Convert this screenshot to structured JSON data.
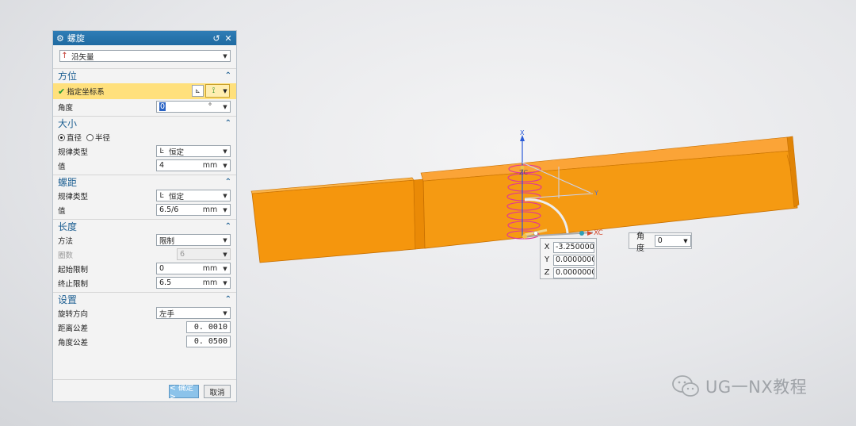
{
  "dialog": {
    "title": "螺旋",
    "type_select": "沿矢量",
    "sections": {
      "orientation": {
        "title": "方位",
        "specify_csys": "指定坐标系",
        "angle_label": "角度",
        "angle_value": "0",
        "angle_unit": "°"
      },
      "size": {
        "title": "大小",
        "radio_diameter": "直径",
        "radio_radius": "半径",
        "law_type_label": "规律类型",
        "law_type_value": "恒定",
        "value_label": "值",
        "value": "4",
        "unit": "mm"
      },
      "pitch": {
        "title": "螺距",
        "law_type_label": "规律类型",
        "law_type_value": "恒定",
        "value_label": "值",
        "value": "6.5/6",
        "unit": "mm"
      },
      "length": {
        "title": "长度",
        "method_label": "方法",
        "method_value": "限制",
        "turns_label": "圈数",
        "turns_value": "6",
        "start_label": "起始限制",
        "start_value": "0",
        "start_unit": "mm",
        "end_label": "终止限制",
        "end_value": "6.5",
        "end_unit": "mm"
      },
      "settings": {
        "title": "设置",
        "rotation_label": "旋转方向",
        "rotation_value": "左手",
        "dist_tol_label": "距离公差",
        "dist_tol_value": "0. 0010",
        "angle_tol_label": "角度公差",
        "angle_tol_value": "0. 0500"
      }
    },
    "buttons": {
      "ok": "< 确定 >",
      "cancel": "取消"
    }
  },
  "viewport": {
    "coords": {
      "x_label": "X",
      "x_value": "-3.2500000",
      "y_label": "Y",
      "y_value": "0.0000000",
      "z_label": "Z",
      "z_value": "0.0000000"
    },
    "angle_label": "角度",
    "angle_value": "0",
    "axis_labels": {
      "x": "X",
      "y": "Y",
      "zc": "ZC",
      "xc": "XC"
    }
  },
  "watermark": "UG一NX教程",
  "colors": {
    "part": "#f5960d",
    "helix": "#e0349a",
    "title_bar": "#2470a9",
    "highlight": "#ffe07c"
  }
}
